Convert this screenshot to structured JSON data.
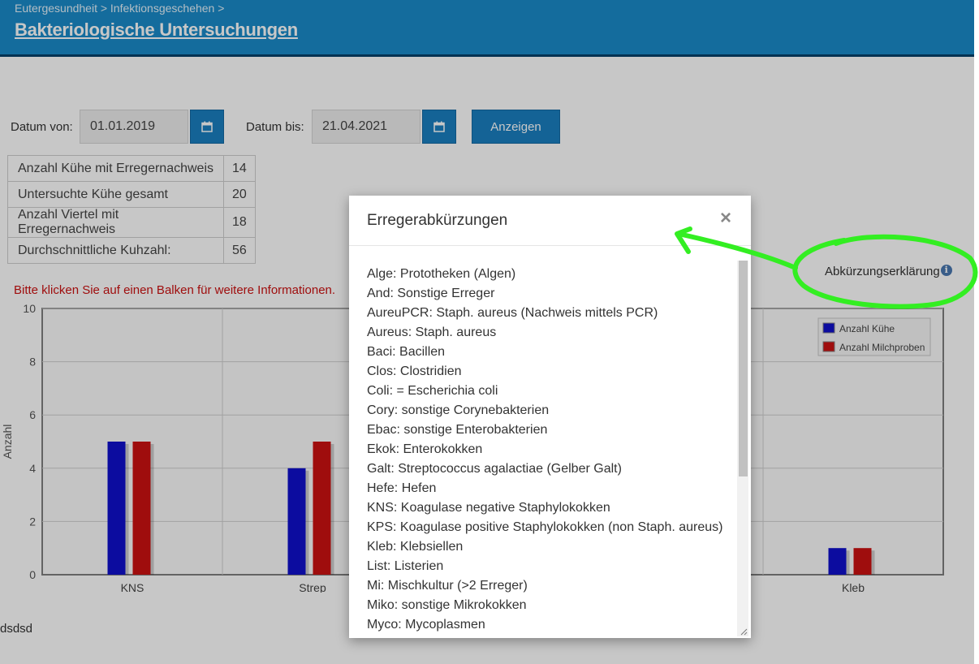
{
  "header": {
    "breadcrumb": "Eutergesundheit > Infektionsgeschehen >",
    "title": "Bakteriologische Untersuchungen"
  },
  "filter": {
    "date_from_label": "Datum von:",
    "date_from_value": "01.01.2019",
    "date_to_label": "Datum bis:",
    "date_to_value": "21.04.2021",
    "show_button": "Anzeigen"
  },
  "stats": [
    {
      "label": "Anzahl Kühe mit Erregernachweis",
      "value": "14"
    },
    {
      "label": "Untersuchte Kühe gesamt",
      "value": "20"
    },
    {
      "label": "Anzahl Viertel mit Erregernachweis",
      "value": "18"
    },
    {
      "label": "Durchschnittliche Kuhzahl:",
      "value": "56"
    }
  ],
  "hint": "Bitte klicken Sie auf einen Balken für weitere Informationen.",
  "abbreviation_link": "Abkürzungserklärung",
  "footer_text": "dsdsd",
  "chart_data": {
    "type": "bar",
    "categories": [
      "KNS",
      "Strep",
      "Kleb"
    ],
    "series": [
      {
        "name": "Anzahl Kühe",
        "color": "#1010cc",
        "values": [
          5,
          4,
          1
        ]
      },
      {
        "name": "Anzahl Milchproben",
        "color": "#cc1111",
        "values": [
          5,
          5,
          1
        ]
      }
    ],
    "ylabel": "Anzahl",
    "ylim": [
      0,
      10
    ],
    "yticks": [
      0,
      2,
      4,
      6,
      8,
      10
    ],
    "grid": true,
    "legend": "top-right"
  },
  "modal": {
    "title": "Erregerabkürzungen",
    "close_symbol": "×",
    "items": [
      "Alge: Prototheken (Algen)",
      "And: Sonstige Erreger",
      "AureuPCR: Staph. aureus (Nachweis mittels PCR)",
      "Aureus: Staph. aureus",
      "Baci: Bacillen",
      "Clos: Clostridien",
      "Coli: = Escherichia coli",
      "Cory: sonstige Corynebakterien",
      "Ebac: sonstige Enterobakterien",
      "Ekok: Enterokokken",
      "Galt: Streptococcus agalactiae (Gelber Galt)",
      "Hefe: Hefen",
      "KNS: Koagulase negative Staphylokokken",
      "KPS: Koagulase positive Staphylokokken (non Staph. aureus)",
      "Kleb: Klebsiellen",
      "List: Listerien",
      "Mi: Mischkultur (>2 Erreger)",
      "Miko: sonstige Mikrokokken",
      "Myco: Mycoplasmen"
    ]
  },
  "colors": {
    "header_bg": "#1a8bc9",
    "button_bg": "#1a7fc0",
    "hint_text": "#cc1111",
    "annotation": "#33ee22"
  }
}
